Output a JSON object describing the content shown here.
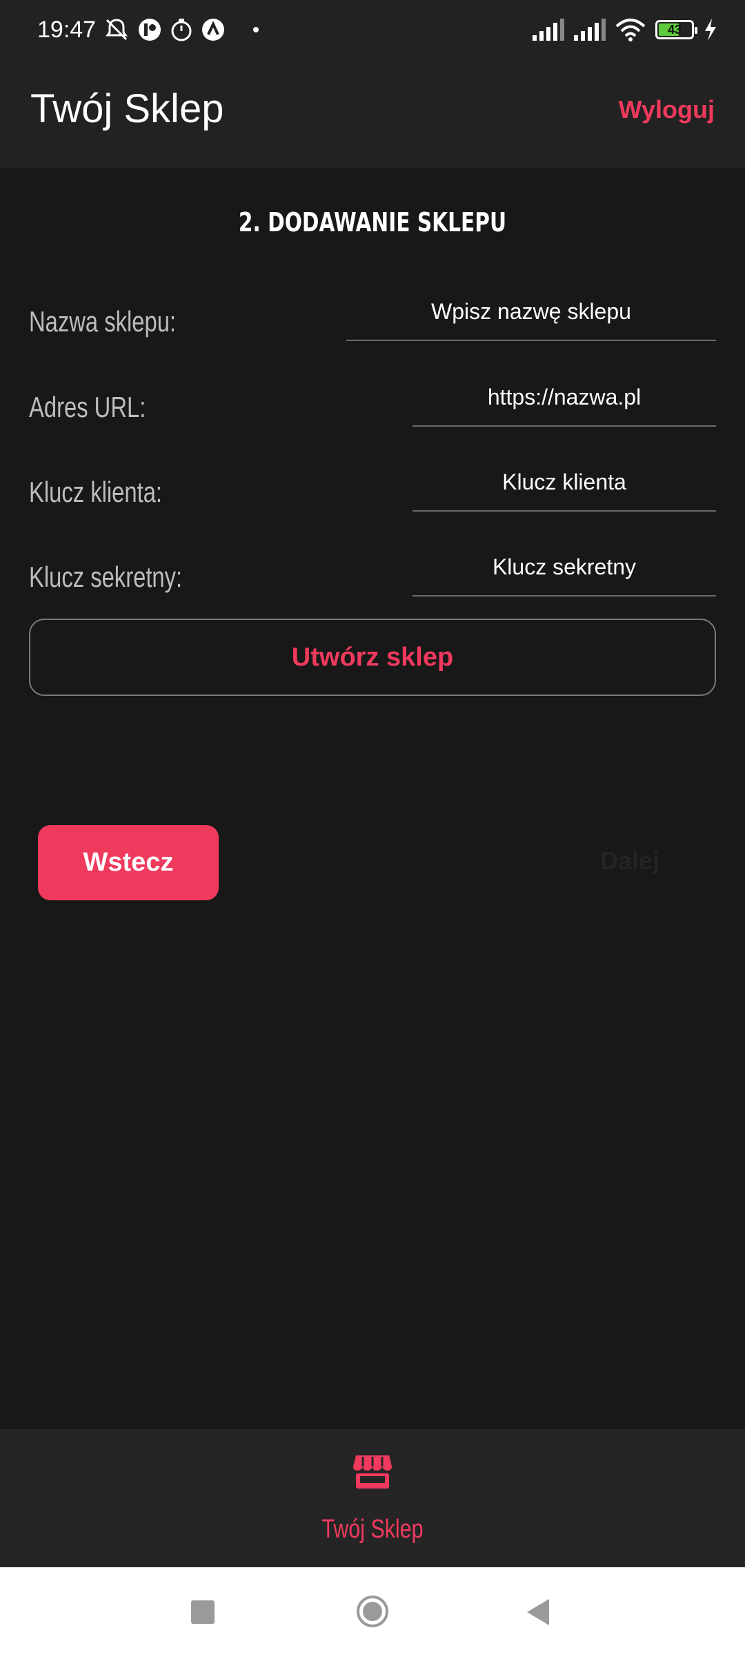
{
  "status_bar": {
    "time": "19:47",
    "icons": [
      "mute-icon",
      "app-icon",
      "timer-icon",
      "nav-app-icon",
      "dot-icon"
    ],
    "right_icons": [
      "signal-icon",
      "signal-icon",
      "wifi-icon",
      "battery-icon",
      "charging-icon"
    ],
    "battery_level": "43"
  },
  "app_bar": {
    "title": "Twój Sklep",
    "logout_label": "Wyloguj"
  },
  "main": {
    "heading": "2. DODAWANIE SKLEPU",
    "fields": {
      "name_label": "Nazwa sklepu:",
      "name_placeholder": "Wpisz nazwę sklepu",
      "url_label": "Adres URL:",
      "url_placeholder": "https://nazwa.pl",
      "client_key_label": "Klucz klienta:",
      "client_key_placeholder": "Klucz klienta",
      "secret_key_label": "Klucz sekretny:",
      "secret_key_placeholder": "Klucz sekretny"
    },
    "create_button": "Utwórz sklep",
    "back_button": "Wstecz",
    "next_button": "Dalej"
  },
  "bottom_nav": {
    "label": "Twój Sklep",
    "icon": "store-icon"
  },
  "colors": {
    "accent": "#ef3a5d",
    "background": "#181818",
    "bar": "#222222"
  }
}
